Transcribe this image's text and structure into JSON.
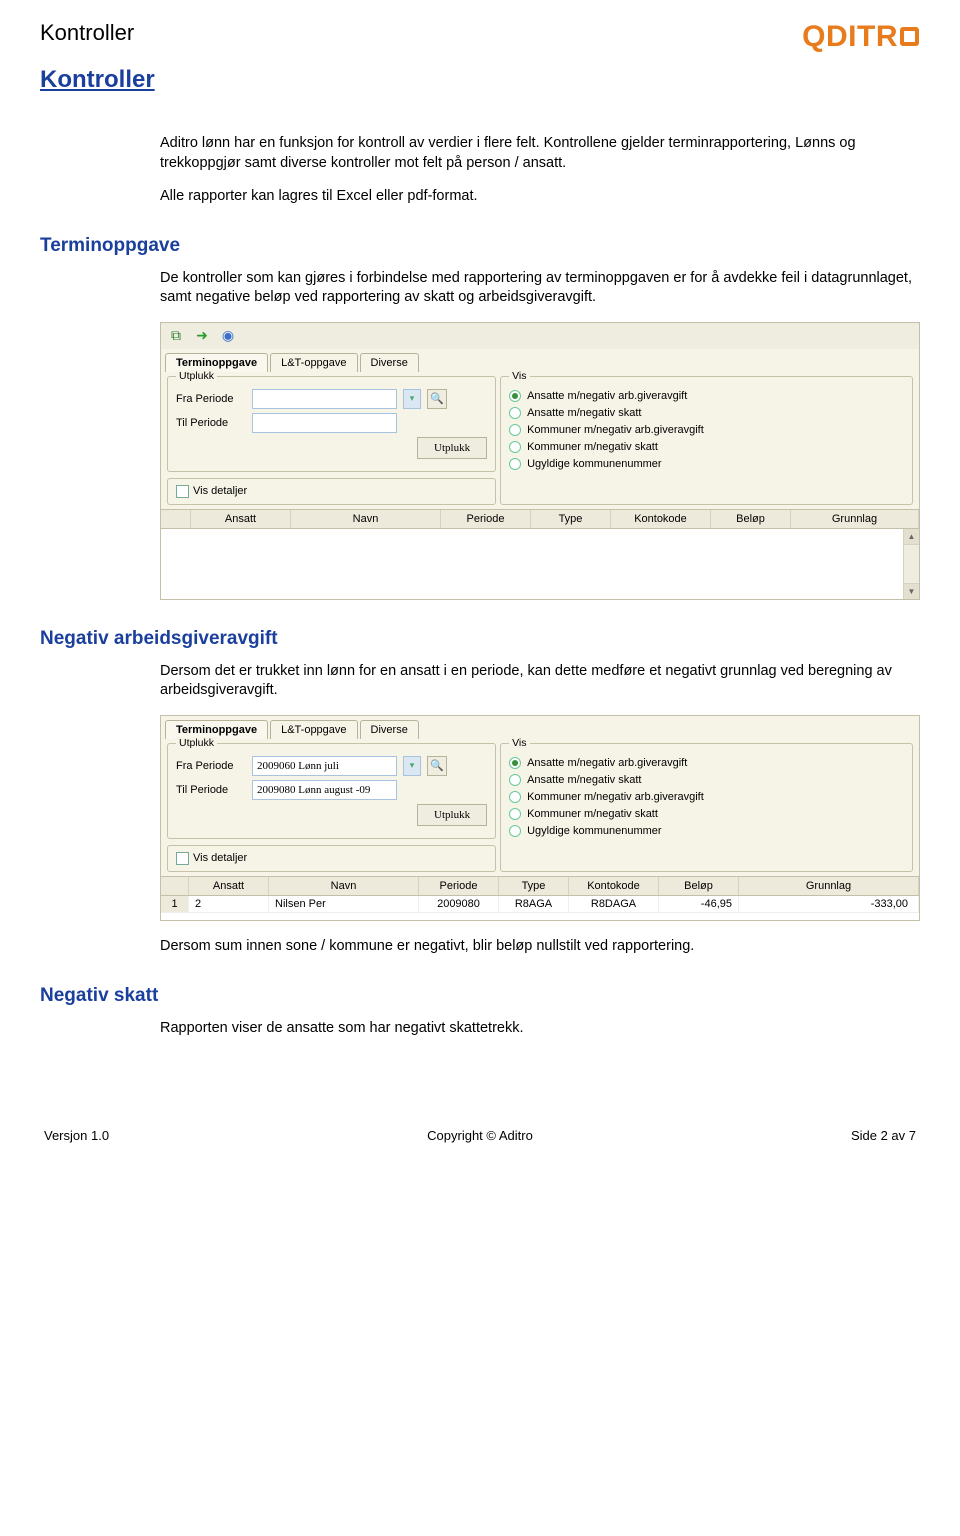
{
  "header": {
    "corner_title": "Kontroller",
    "logo_text": "QDITR"
  },
  "title_link": "Kontroller",
  "intro": {
    "p1": "Aditro lønn har en funksjon for kontroll av verdier i flere felt. Kontrollene gjelder terminrapportering, Lønns og trekkoppgjør samt diverse kontroller mot felt på person / ansatt.",
    "p2": "Alle rapporter kan lagres til Excel eller pdf-format."
  },
  "section1": {
    "heading": "Terminoppgave",
    "para": "De kontroller som kan gjøres i forbindelse med rapportering av terminoppgaven er for å avdekke feil i datagrunnlaget, samt negative beløp ved rapportering av skatt og arbeidsgiveravgift."
  },
  "app": {
    "tabs": [
      "Terminoppgave",
      "L&T-oppgave",
      "Diverse"
    ],
    "utplukk_legend": "Utplukk",
    "fra_label": "Fra Periode",
    "til_label": "Til Periode",
    "utplukk_btn": "Utplukk",
    "vis_detaljer": "Vis detaljer",
    "vis_legend": "Vis",
    "vis_options": [
      "Ansatte m/negativ arb.giveravgift",
      "Ansatte m/negativ skatt",
      "Kommuner m/negativ arb.giveravgift",
      "Kommuner m/negativ skatt",
      "Ugyldige kommunenummer"
    ],
    "grid_cols_a": [
      "Ansatt",
      "Navn",
      "Periode",
      "Type",
      "Kontokode",
      "Beløp",
      "Grunnlag"
    ],
    "grid_cols_b": [
      "",
      "Ansatt",
      "Navn",
      "Periode",
      "Type",
      "Kontokode",
      "Beløp",
      "Grunnlag"
    ]
  },
  "section2": {
    "heading": "Negativ arbeidsgiveravgift",
    "para": "Dersom det er trukket inn lønn for en ansatt i en periode, kan dette medføre et negativt grunnlag ved beregning av arbeidsgiveravgift.",
    "fra_value": "2009060 Lønn juli",
    "til_value": "2009080 Lønn august -09",
    "row": {
      "n": "1",
      "ansatt": "2",
      "navn": "Nilsen Per",
      "periode": "2009080",
      "type": "R8AGA",
      "konto": "R8DAGA",
      "belop": "-46,95",
      "grunnlag": "-333,00"
    },
    "after_para": "Dersom sum innen sone / kommune er negativt, blir beløp nullstilt ved rapportering."
  },
  "section3": {
    "heading": "Negativ skatt",
    "para": "Rapporten viser de ansatte som har negativt skattetrekk."
  },
  "footer": {
    "left": "Versjon 1.0",
    "center": "Copyright © Aditro",
    "right": "Side 2 av 7"
  }
}
